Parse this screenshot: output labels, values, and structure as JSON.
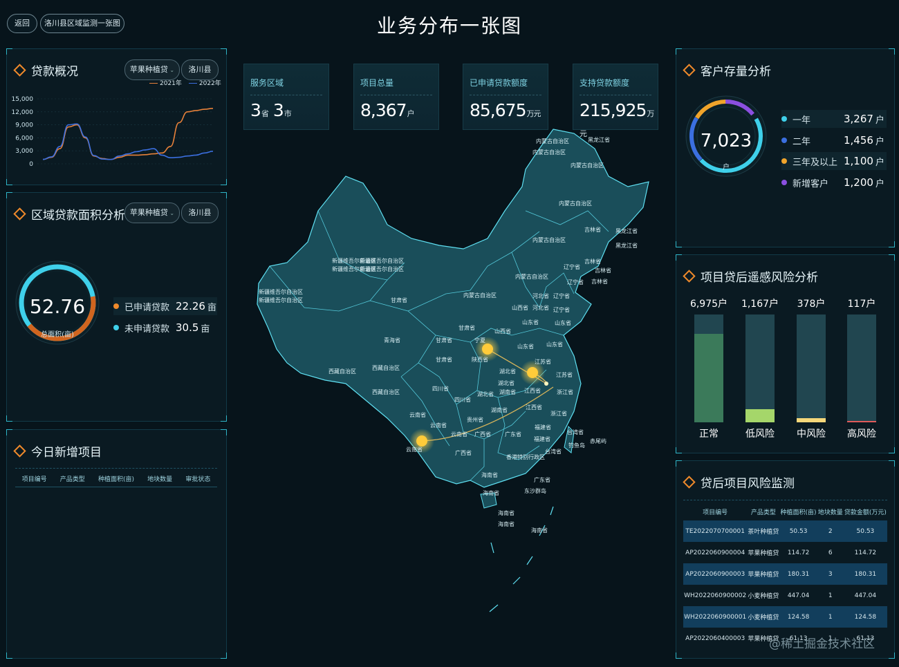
{
  "header": {
    "back_label": "返回",
    "breadcrumb_label": "洛川县区域监测一张图",
    "page_title": "业务分布一张图"
  },
  "loan_overview": {
    "title": "贷款概况",
    "product_select": "苹果种植贷",
    "county_select": "洛川县",
    "legend_2021": "2021年",
    "legend_2022": "2022年",
    "colors": {
      "y2021": "#e7813a",
      "y2022": "#3b6fe0"
    },
    "chart_data": {
      "type": "line",
      "yticks": [
        "15,000",
        "12,000",
        "9,000",
        "6,000",
        "3,000",
        "0"
      ],
      "ylim": [
        0,
        15000
      ],
      "x": [
        0,
        1,
        2,
        3,
        4,
        5,
        6,
        7,
        8,
        9,
        10,
        11,
        12,
        13,
        14,
        15,
        16,
        17,
        18,
        19,
        20
      ],
      "series": [
        {
          "name": "2021年",
          "values": [
            1000,
            1500,
            3500,
            8500,
            9000,
            6000,
            1800,
            1200,
            1000,
            1500,
            2000,
            2000,
            2100,
            2300,
            2500,
            4000,
            9500,
            12000,
            12300,
            12600,
            12800
          ]
        },
        {
          "name": "2022年",
          "values": [
            1000,
            1600,
            4000,
            9000,
            9200,
            6200,
            1900,
            1100,
            1000,
            1800,
            2300,
            2800,
            3200,
            3500,
            2000,
            1400,
            1500,
            1800,
            2000,
            2500,
            2900
          ]
        }
      ]
    }
  },
  "area_analysis": {
    "title": "区域贷款面积分析",
    "product_select": "苹果种植贷",
    "county_select": "洛川县",
    "total_value": "52.76",
    "total_label": "总面积(亩)",
    "applied_fraction": 0.42,
    "items": [
      {
        "label": "已申请贷款",
        "value": "22.26",
        "unit": "亩",
        "color": "#f08a2b"
      },
      {
        "label": "未申请贷款",
        "value": "30.5",
        "unit": "亩",
        "color": "#3fd0ea"
      }
    ]
  },
  "today_projects": {
    "title": "今日新增项目",
    "columns": [
      "项目编号",
      "产品类型",
      "种植面积(亩)",
      "地块数量",
      "审批状态"
    ]
  },
  "stats": [
    {
      "label": "服务区域",
      "value1": "3",
      "unit1": "省",
      "value2": "3",
      "unit2": "市"
    },
    {
      "label": "项目总量",
      "value1": "8,367",
      "unit1": "户"
    },
    {
      "label": "已申请贷款额度",
      "value1": "85,675",
      "unit1": "万元"
    },
    {
      "label": "支持贷款额度",
      "value1": "215,925",
      "unit1": "万元"
    }
  ],
  "map": {
    "labels": [
      "内蒙古自治区",
      "内蒙古自治区",
      "黑龙江省",
      "内蒙古自治区",
      "内蒙古自治区",
      "吉林省",
      "黑龙江省",
      "黑龙江省",
      "内蒙古自治区",
      "吉林省",
      "吉林省",
      "吉林省",
      "辽宁省",
      "内蒙古自治区",
      "辽宁省",
      "新疆维吾尔自治区",
      "新疆维吾尔自治区",
      "新疆维吾尔自治区",
      "新疆维吾尔自治区",
      "新疆维吾尔自治区",
      "新疆维吾尔自治区",
      "甘肃省",
      "内蒙古自治区",
      "河北省",
      "辽宁省",
      "山西省",
      "河北省",
      "辽宁省",
      "山东省",
      "山东省",
      "青海省",
      "甘肃省",
      "宁夏",
      "甘肃省",
      "山西省",
      "山东省",
      "山东省",
      "甘肃省",
      "陕西省",
      "江苏省",
      "西藏自治区",
      "西藏自治区",
      "湖北省",
      "江苏省",
      "西藏自治区",
      "四川省",
      "湖北省",
      "浙江省",
      "四川省",
      "湖北省",
      "湖南省",
      "江西省",
      "浙江省",
      "云南省",
      "贵州省",
      "湖南省",
      "江西省",
      "福建省",
      "云南省",
      "云南省",
      "广西省",
      "广东省",
      "福建省",
      "台湾省",
      "云南省",
      "广西省",
      "钓鱼岛",
      "赤尾屿",
      "香港特别行政区",
      "台湾省",
      "广东省",
      "海南省",
      "东沙群岛",
      "海南省",
      "海南省",
      "海南省",
      "海南省"
    ]
  },
  "customer_stock": {
    "title": "客户存量分析",
    "total": "7,023",
    "total_unit": "户",
    "items": [
      {
        "label": "一年",
        "value": "3,267",
        "unit": "户",
        "color": "#3fd0ea"
      },
      {
        "label": "二年",
        "value": "1,456",
        "unit": "户",
        "color": "#3b6fe0"
      },
      {
        "label": "三年及以上",
        "value": "1,100",
        "unit": "户",
        "color": "#f0a42b"
      },
      {
        "label": "新增客户",
        "value": "1,200",
        "unit": "户",
        "color": "#8b4fe0"
      }
    ]
  },
  "risk_analysis": {
    "title": "项目贷后遥感风险分析",
    "bars": [
      {
        "value": "6,975户",
        "label": "正常",
        "fill": 0.82,
        "color": "#3b7a5a"
      },
      {
        "value": "1,167户",
        "label": "低风险",
        "fill": 0.12,
        "color": "#a5d66a"
      },
      {
        "value": "378户",
        "label": "中风险",
        "fill": 0.04,
        "color": "#f5d77a"
      },
      {
        "value": "117户",
        "label": "高风险",
        "fill": 0.01,
        "color": "#e05a5a"
      }
    ]
  },
  "risk_monitor": {
    "title": "贷后项目风险监测",
    "columns": [
      "项目编号",
      "产品类型",
      "种植面积(亩)",
      "地块数量",
      "贷款金额(万元)"
    ],
    "rows": [
      [
        "TE2022070700001",
        "茶叶种植贷",
        "50.53",
        "2",
        "50.53"
      ],
      [
        "AP2022060900004",
        "苹果种植贷",
        "114.72",
        "6",
        "114.72"
      ],
      [
        "AP2022060900003",
        "苹果种植贷",
        "180.31",
        "3",
        "180.31"
      ],
      [
        "WH2022060900002",
        "小麦种植贷",
        "447.04",
        "1",
        "447.04"
      ],
      [
        "WH2022060900001",
        "小麦种植贷",
        "124.58",
        "1",
        "124.58"
      ],
      [
        "AP2022060400003",
        "苹果种植贷",
        "61.13",
        "1",
        "61.13"
      ]
    ]
  },
  "watermark": "@稀土掘金技术社区"
}
